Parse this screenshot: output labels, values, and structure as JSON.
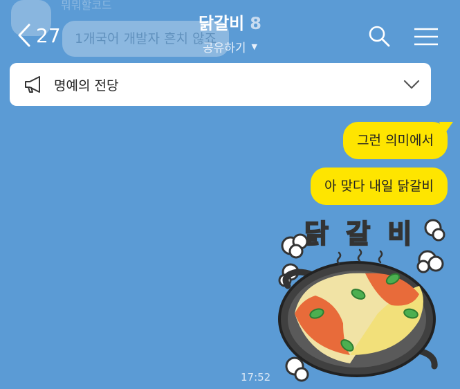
{
  "header": {
    "back_count": "27",
    "title": "닭갈비",
    "member_count": "8",
    "subtitle": "공유하기"
  },
  "ghost_preview": {
    "name": "뭐뭐할코드",
    "message": "1개국어 개발자 흔치 않죠"
  },
  "notice": {
    "label": "명예의 전당"
  },
  "messages": [
    {
      "text": "그런 의미에서",
      "sender": "me"
    },
    {
      "text": "아 맞다 내일 닭갈비",
      "sender": "me"
    }
  ],
  "sticker": {
    "text": "닭 갈 비"
  },
  "timestamp": "17:52",
  "colors": {
    "background": "#5b9bd5",
    "my_bubble": "#fee500",
    "notice_bg": "#ffffff"
  },
  "icons": [
    "chevron-left-icon",
    "search-icon",
    "menu-icon",
    "megaphone-icon",
    "chevron-down-icon"
  ]
}
